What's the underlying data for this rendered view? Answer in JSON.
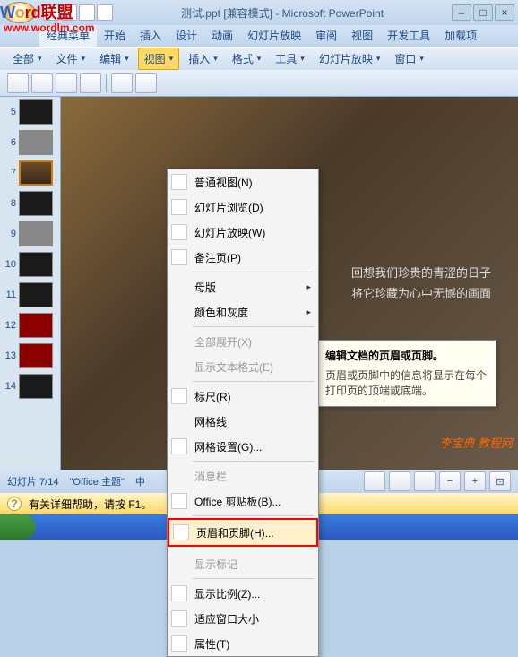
{
  "titlebar": {
    "title": "测试.ppt [兼容模式] - Microsoft PowerPoint"
  },
  "watermark": {
    "brand_pre": "W",
    "brand_o": "o",
    "brand_post": "rd联盟",
    "url": "www.wordlm.com"
  },
  "ribbon": {
    "tabs": [
      "经典菜单",
      "开始",
      "插入",
      "设计",
      "动画",
      "幻灯片放映",
      "审阅",
      "视图",
      "开发工具",
      "加载项"
    ],
    "active_index": 0
  },
  "classic_menu": {
    "items": [
      "全部",
      "文件",
      "编辑",
      "视图",
      "插入",
      "格式",
      "工具",
      "幻灯片放映",
      "窗口"
    ],
    "active_index": 3
  },
  "dropdown": {
    "items": [
      {
        "label": "普通视图(N)",
        "icon": "normal-view-icon"
      },
      {
        "label": "幻灯片浏览(D)",
        "icon": "sorter-icon"
      },
      {
        "label": "幻灯片放映(W)",
        "icon": "slideshow-icon"
      },
      {
        "label": "备注页(P)",
        "icon": "notes-icon"
      },
      {
        "label": "母版",
        "submenu": true
      },
      {
        "label": "颜色和灰度",
        "submenu": true
      },
      {
        "label": "全部展开(X)",
        "disabled": true
      },
      {
        "label": "显示文本格式(E)",
        "disabled": true
      },
      {
        "label": "标尺(R)",
        "icon": "ruler-icon"
      },
      {
        "label": "网格线"
      },
      {
        "label": "网格设置(G)...",
        "icon": "grid-icon"
      },
      {
        "label": "消息栏",
        "disabled": true
      },
      {
        "label": "Office 剪贴板(B)...",
        "icon": "clipboard-icon"
      },
      {
        "label": "页眉和页脚(H)...",
        "icon": "header-footer-icon",
        "highlighted": true
      },
      {
        "label": "显示标记",
        "disabled": true
      },
      {
        "label": "显示比例(Z)...",
        "icon": "zoom-icon"
      },
      {
        "label": "适应窗口大小",
        "icon": "fit-icon"
      },
      {
        "label": "属性(T)",
        "icon": "properties-icon"
      }
    ]
  },
  "thumbnails": {
    "items": [
      {
        "num": "5",
        "cls": "dark"
      },
      {
        "num": "6",
        "cls": "light"
      },
      {
        "num": "7",
        "cls": "warm",
        "selected": true
      },
      {
        "num": "8",
        "cls": "dark"
      },
      {
        "num": "9",
        "cls": "light"
      },
      {
        "num": "10",
        "cls": "dark"
      },
      {
        "num": "11",
        "cls": "dark"
      },
      {
        "num": "12",
        "cls": "red"
      },
      {
        "num": "13",
        "cls": "red"
      },
      {
        "num": "14",
        "cls": "dark"
      }
    ]
  },
  "slide": {
    "line1": "回想我们珍贵的青涩的日子",
    "line2": "将它珍藏为心中无憾的画面"
  },
  "tooltip": {
    "title": "编辑文档的页眉或页脚。",
    "desc": "页眉或页脚中的信息将显示在每个打印页的顶端或底端。"
  },
  "status": {
    "slide_counter": "幻灯片 7/14",
    "theme": "\"Office 主题\"",
    "lang": "中"
  },
  "helpbar": {
    "text": "有关详细帮助，请按 F1。"
  },
  "watermark_br": "李宝典 教程网"
}
